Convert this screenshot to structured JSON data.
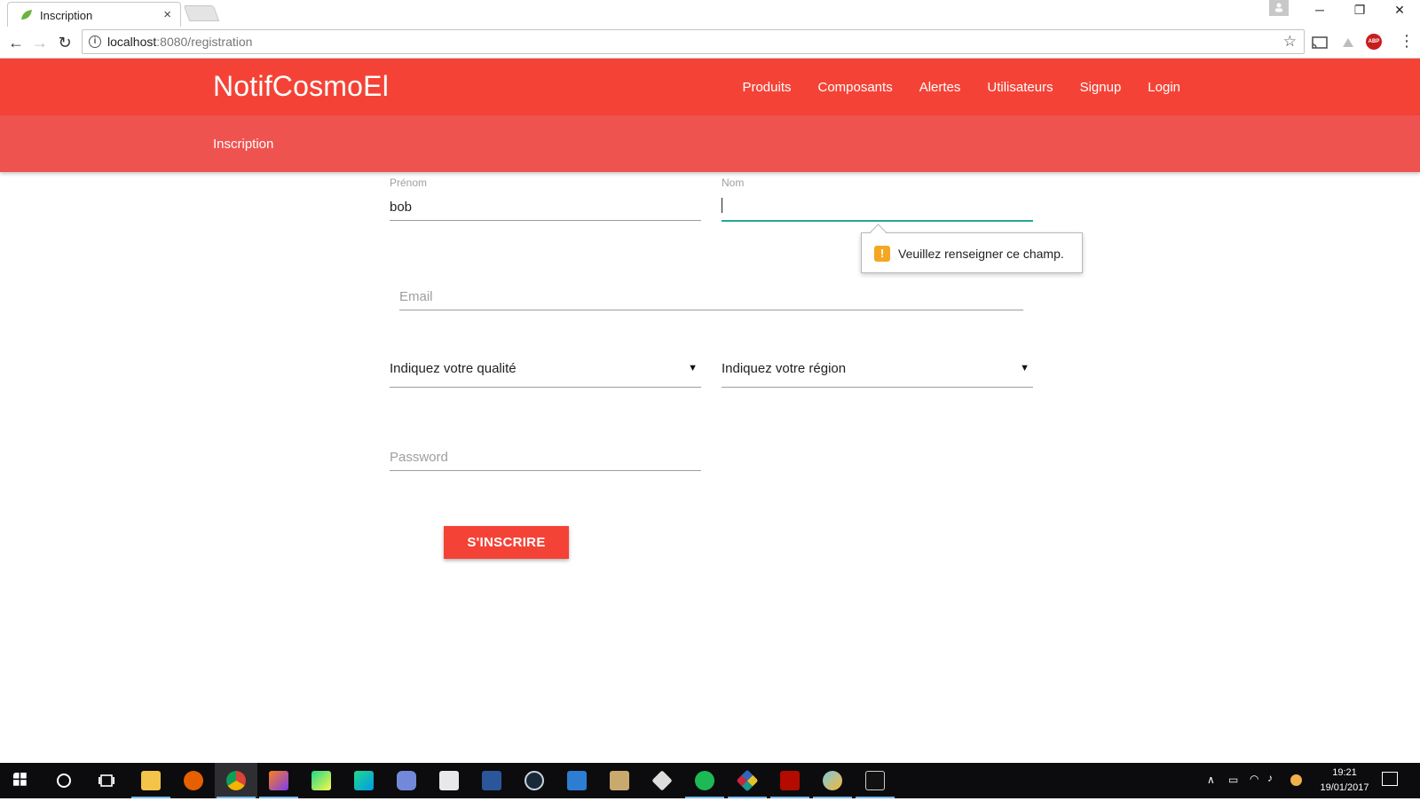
{
  "browser": {
    "tab_title": "Inscription",
    "tab_close": "×",
    "url_host": "localhost",
    "url_rest": ":8080/registration",
    "window_controls": [
      "─",
      "❐",
      "✕"
    ]
  },
  "app": {
    "brand": "NotifCosmoEl",
    "nav": [
      "Produits",
      "Composants",
      "Alertes",
      "Utilisateurs",
      "Signup",
      "Login"
    ],
    "page_title": "Inscription",
    "accent_color": "#f44336",
    "focus_color": "#26a69a"
  },
  "form": {
    "prenom_label": "Prénom",
    "prenom_value": "bob",
    "nom_label": "Nom",
    "nom_value": "",
    "email_placeholder": "Email",
    "qualite_value": "Indiquez votre qualité",
    "region_value": "Indiquez votre région",
    "password_placeholder": "Password",
    "submit_label": "S'INSCRIRE",
    "validation_message": "Veuillez renseigner ce champ.",
    "validation_icon": "!"
  },
  "taskbar": {
    "apps": [
      "windows-start",
      "cortana-search",
      "task-view",
      "file-explorer",
      "firefox",
      "chrome",
      "intellij",
      "pycharm",
      "clion",
      "discord",
      "texstudio",
      "word",
      "steam",
      "visual-studio",
      "league-of-legends",
      "unity",
      "spotify",
      "gitkraken",
      "acrobat",
      "paint",
      "terminal"
    ],
    "time": "19:21",
    "date": "19/01/2017"
  }
}
